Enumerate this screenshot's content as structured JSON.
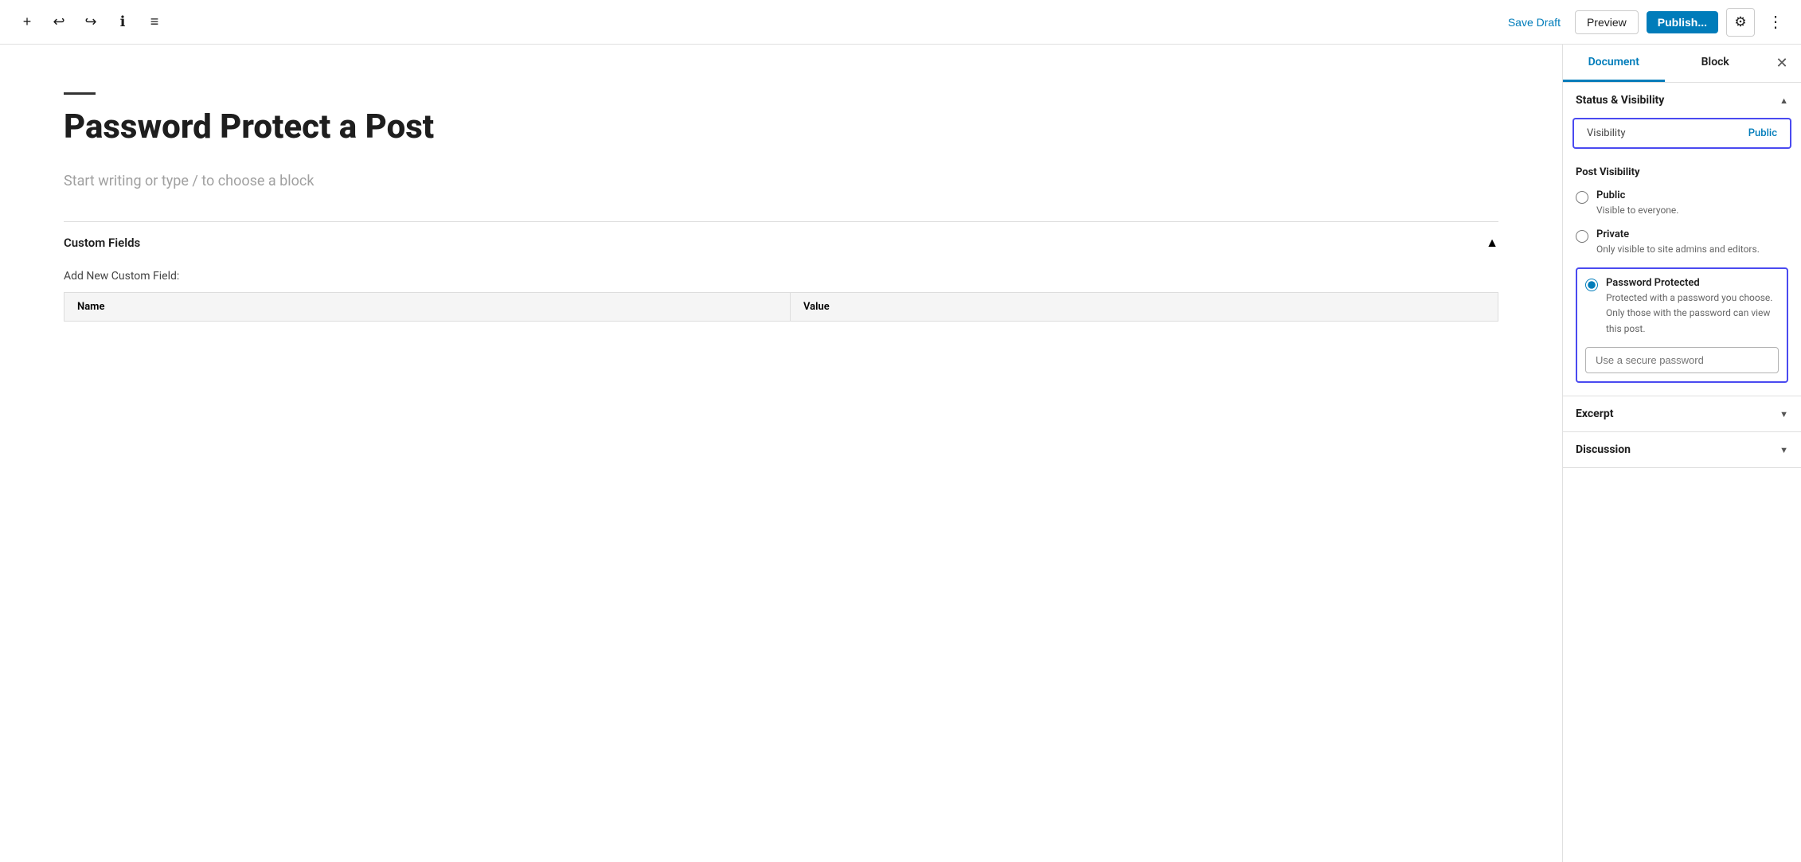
{
  "toolbar": {
    "add_label": "+",
    "undo_label": "↩",
    "redo_label": "↪",
    "info_label": "ℹ",
    "list_label": "≡",
    "save_draft_label": "Save Draft",
    "preview_label": "Preview",
    "publish_label": "Publish...",
    "settings_label": "⚙",
    "more_label": "⋮"
  },
  "editor": {
    "separator_visible": true,
    "post_title": "Password Protect a Post",
    "placeholder": "Start writing or type / to choose a block"
  },
  "custom_fields": {
    "title": "Custom Fields",
    "add_label": "Add New Custom Field:",
    "columns": [
      "Name",
      "Value"
    ]
  },
  "sidebar": {
    "tabs": [
      {
        "id": "document",
        "label": "Document"
      },
      {
        "id": "block",
        "label": "Block"
      }
    ],
    "active_tab": "document",
    "sections": {
      "status_visibility": {
        "title": "Status & Visibility",
        "expanded": true,
        "visibility_label": "Visibility",
        "visibility_value": "Public",
        "post_visibility_title": "Post Visibility",
        "options": [
          {
            "id": "public",
            "label": "Public",
            "description": "Visible to everyone.",
            "selected": false
          },
          {
            "id": "private",
            "label": "Private",
            "description": "Only visible to site admins and editors.",
            "selected": false
          },
          {
            "id": "password",
            "label": "Password Protected",
            "description": "Protected with a password you choose. Only those with the password can view this post.",
            "selected": true
          }
        ],
        "password_placeholder": "Use a secure password"
      },
      "excerpt": {
        "title": "Excerpt",
        "expanded": false
      },
      "discussion": {
        "title": "Discussion",
        "expanded": false
      }
    }
  }
}
